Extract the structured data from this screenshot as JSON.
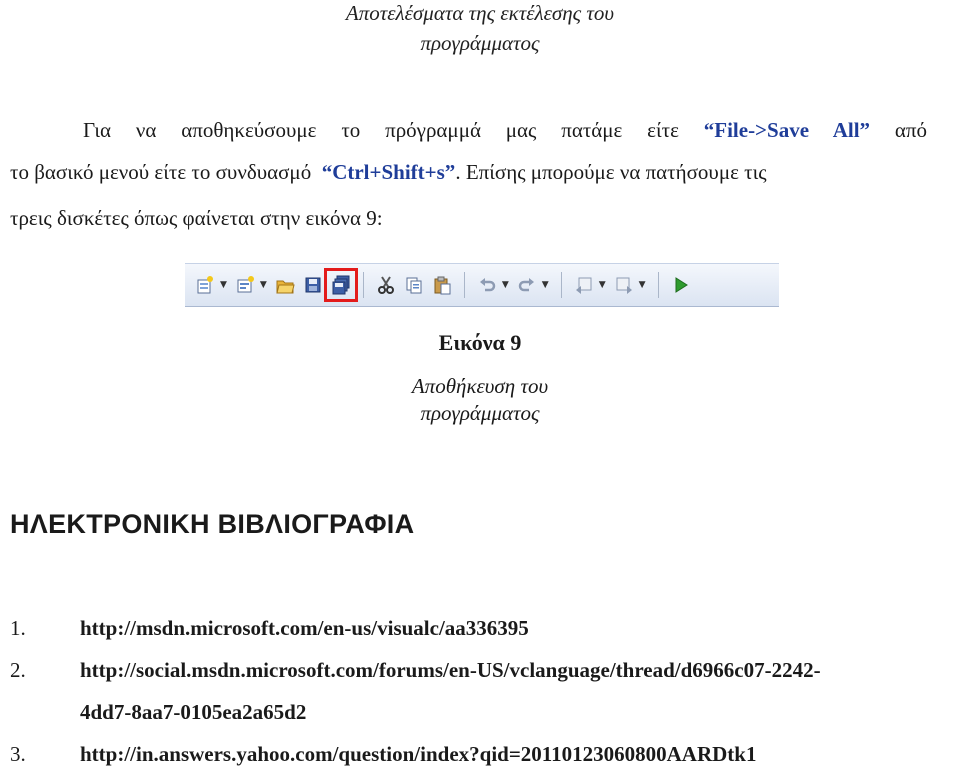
{
  "header_caption": {
    "line1": "Αποτελέσματα της εκτέλεσης του",
    "line2": "προγράμματος"
  },
  "paragraph": {
    "line1_a": "Για να αποθηκεύσουμε το πρόγραμμά μας πατάμε είτε",
    "line1_kw": "“File->Save All”",
    "line1_b": "από",
    "line2_a": "το βασικό μενού είτε το συνδυασμό",
    "line2_kw": "“Ctrl+Shift+s”",
    "line2_b": ". Επίσης μπορούμε να πατήσουμε τις",
    "line3": "τρεις δισκέτες όπως φαίνεται στην εικόνα 9:"
  },
  "toolbar": {
    "icons": [
      "new-project-icon",
      "add-item-icon",
      "open-file-icon",
      "save-icon",
      "save-all-icon",
      "cut-icon",
      "copy-icon",
      "paste-icon",
      "undo-icon",
      "redo-icon",
      "navigate-backward-icon",
      "navigate-forward-icon",
      "start-debugging-icon"
    ],
    "highlight_color": "#e31b1b"
  },
  "figure": {
    "title": "Εικόνα 9",
    "caption_line1": "Αποθήκευση του",
    "caption_line2": "προγράμματος"
  },
  "section_heading": "ΗΛΕΚΤΡΟΝΙΚΗ ΒΙΒΛΙΟΓΡΑΦΙΑ",
  "references": [
    {
      "num": "1.",
      "url": "http://msdn.microsoft.com/en-us/visualc/aa336395"
    },
    {
      "num": "2.",
      "url": "http://social.msdn.microsoft.com/forums/en-US/vclanguage/thread/d6966c07-2242-",
      "url_cont": "4dd7-8aa7-0105ea2a65d2"
    },
    {
      "num": "3.",
      "url": "http://in.answers.yahoo.com/question/index?qid=20110123060800AARDtk1"
    }
  ]
}
